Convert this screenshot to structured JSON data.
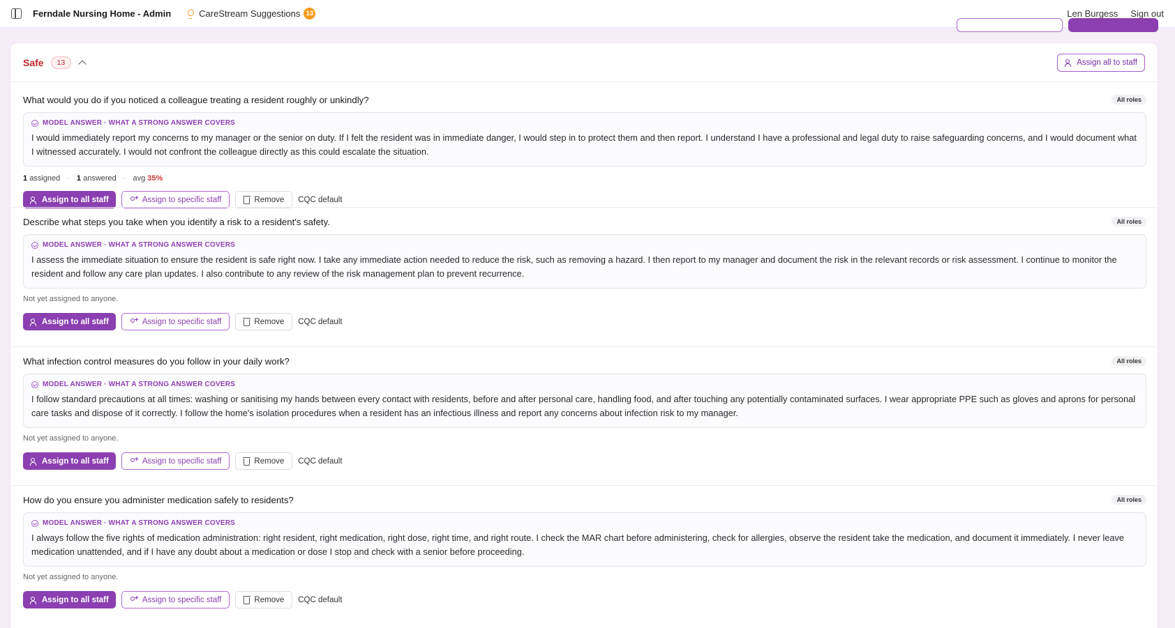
{
  "topbar": {
    "app_title": "Ferndale Nursing Home - Admin",
    "suggestions_label": "CareStream Suggestions",
    "suggestions_count": "13",
    "user_name": "Len Burgess",
    "sign_out": "Sign out"
  },
  "section": {
    "title": "Safe",
    "count": "13",
    "assign_all_label": "Assign all to staff"
  },
  "labels": {
    "model_answer": "MODEL ANSWER · WHAT A STRONG ANSWER COVERS",
    "all_roles": "All roles",
    "assign_all": "Assign to all staff",
    "assign_specific": "Assign to specific staff",
    "remove": "Remove",
    "cqc_default": "CQC default",
    "not_assigned": "Not yet assigned to anyone.",
    "assigned_suffix": "assigned",
    "answered_suffix": "answered",
    "avg_prefix": "avg"
  },
  "questions": [
    {
      "question": "What would you do if you noticed a colleague treating a resident roughly or unkindly?",
      "answer": "I would immediately report my concerns to my manager or the senior on duty. If I felt the resident was in immediate danger, I would step in to protect them and then report. I understand I have a professional and legal duty to raise safeguarding concerns, and I would document what I witnessed accurately. I would not confront the colleague directly as this could escalate the situation.",
      "assigned": "1",
      "answered": "1",
      "avg": "35%"
    },
    {
      "question": "Describe what steps you take when you identify a risk to a resident's safety.",
      "answer": "I assess the immediate situation to ensure the resident is safe right now. I take any immediate action needed to reduce the risk, such as removing a hazard. I then report to my manager and document the risk in the relevant records or risk assessment. I continue to monitor the resident and follow any care plan updates. I also contribute to any review of the risk management plan to prevent recurrence."
    },
    {
      "question": "What infection control measures do you follow in your daily work?",
      "answer": "I follow standard precautions at all times: washing or sanitising my hands between every contact with residents, before and after personal care, handling food, and after touching any potentially contaminated surfaces. I wear appropriate PPE such as gloves and aprons for personal care tasks and dispose of it correctly. I follow the home's isolation procedures when a resident has an infectious illness and report any concerns about infection risk to my manager."
    },
    {
      "question": "How do you ensure you administer medication safely to residents?",
      "answer": "I always follow the five rights of medication administration: right resident, right medication, right dose, right time, and right route. I check the MAR chart before administering, check for allergies, observe the resident take the medication, and document it immediately. I never leave medication unattended, and if I have any doubt about a medication or dose I stop and check with a senior before proceeding."
    }
  ]
}
